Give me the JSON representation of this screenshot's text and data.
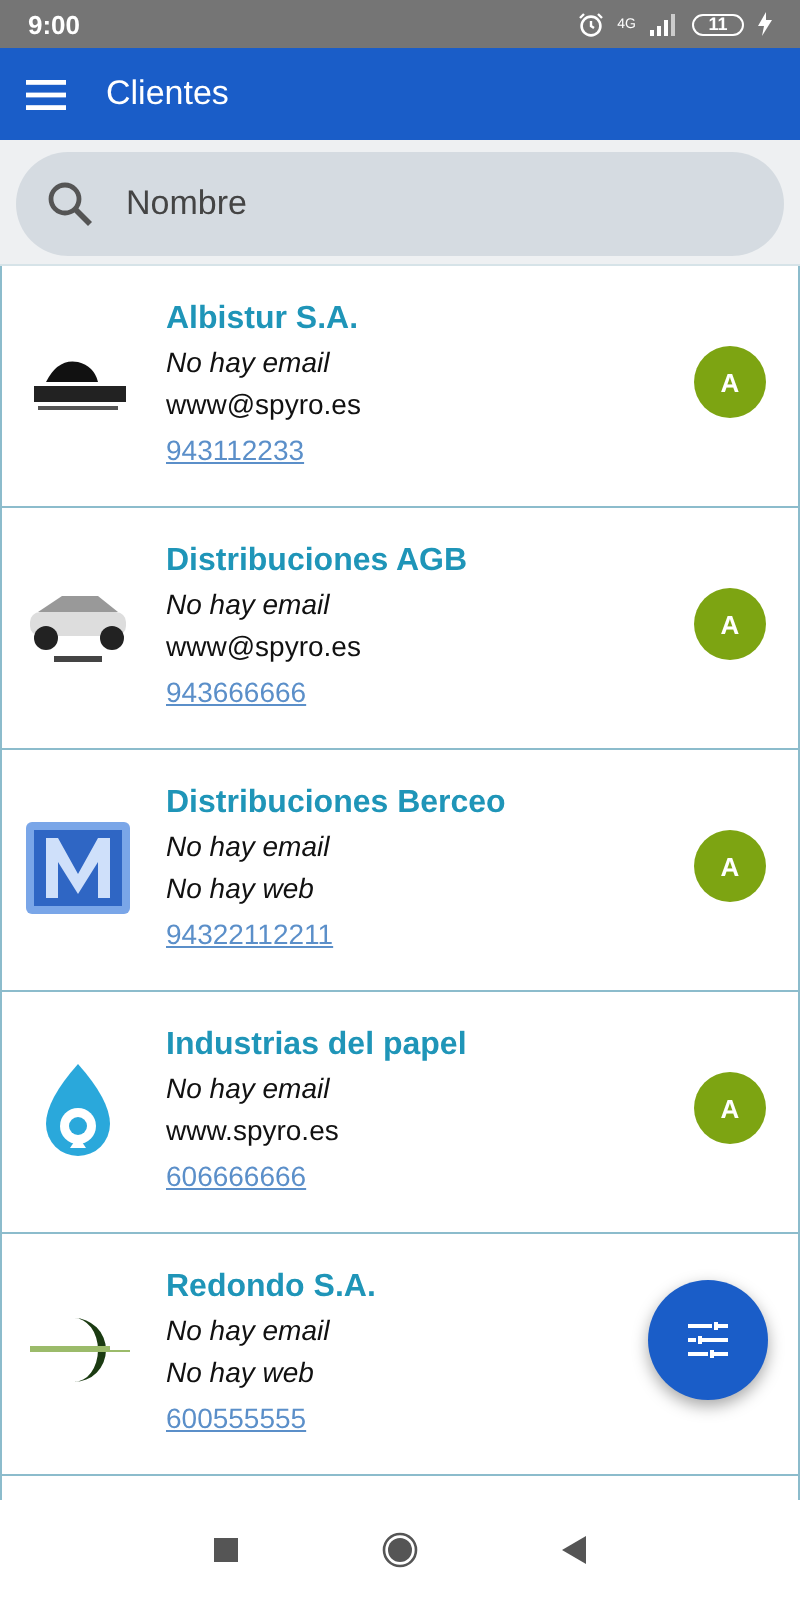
{
  "status_bar": {
    "time": "9:00",
    "network": "4G",
    "battery": "11"
  },
  "app_bar": {
    "title": "Clientes"
  },
  "search": {
    "placeholder": "Nombre"
  },
  "clients": [
    {
      "name": "Albistur S.A.",
      "email": {
        "text": "No hay email",
        "missing": true
      },
      "web": {
        "text": "www@spyro.es",
        "missing": false
      },
      "phone": "943112233",
      "badge": {
        "text": "A",
        "color": "#7da412"
      }
    },
    {
      "name": "Distribuciones AGB",
      "email": {
        "text": "No hay email",
        "missing": true
      },
      "web": {
        "text": "www@spyro.es",
        "missing": false
      },
      "phone": "943666666",
      "badge": {
        "text": "A",
        "color": "#7da412"
      }
    },
    {
      "name": "Distribuciones Berceo",
      "email": {
        "text": "No hay email",
        "missing": true
      },
      "web": {
        "text": "No hay web",
        "missing": true
      },
      "phone": "94322112211",
      "badge": {
        "text": "A",
        "color": "#7da412"
      }
    },
    {
      "name": "Industrias del papel",
      "email": {
        "text": "No hay email",
        "missing": true
      },
      "web": {
        "text": "www.spyro.es",
        "missing": false
      },
      "phone": "606666666",
      "badge": {
        "text": "A",
        "color": "#7da412"
      }
    },
    {
      "name": "Redondo S.A.",
      "email": {
        "text": "No hay email",
        "missing": true
      },
      "web": {
        "text": "No hay web",
        "missing": true
      },
      "phone": "600555555"
    }
  ]
}
